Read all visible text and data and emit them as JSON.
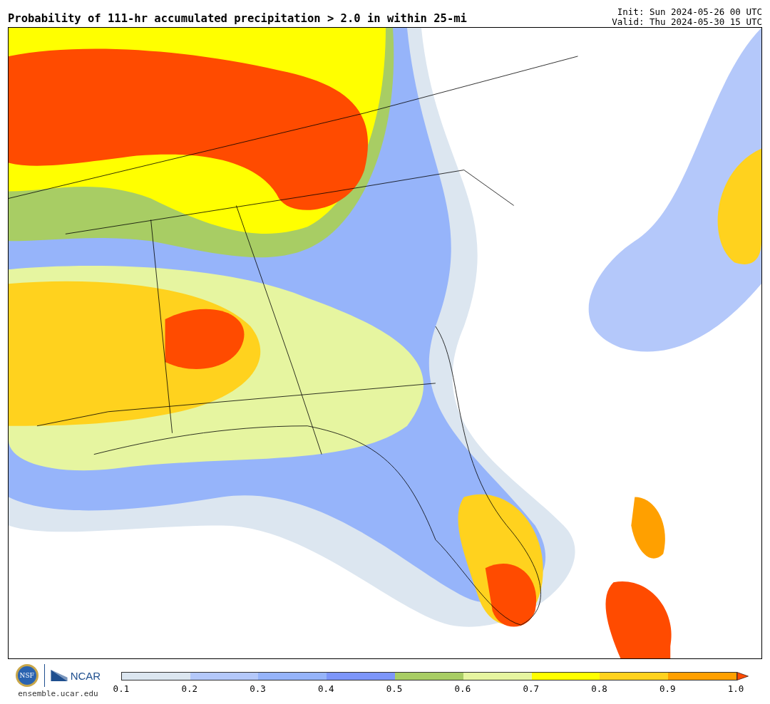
{
  "title": "Probability of 111-hr accumulated precipitation > 2.0 in within 25-mi",
  "init": "Init: Sun 2024-05-26 00 UTC",
  "valid": "Valid: Thu 2024-05-30 15 UTC",
  "logos": {
    "nsf": "NSF",
    "ncar": "NCAR",
    "site": "ensemble.ucar.edu"
  },
  "legend": {
    "segments": [
      {
        "color": "#dce6f0"
      },
      {
        "color": "#b4c8fa"
      },
      {
        "color": "#96b4fa"
      },
      {
        "color": "#7d96fa"
      },
      {
        "color": "#a8cd64"
      },
      {
        "color": "#e6f5a0"
      },
      {
        "color": "#ffff00"
      },
      {
        "color": "#ffd21e"
      },
      {
        "color": "#ffa000"
      }
    ],
    "overflow": {
      "color": "#ff4b00"
    },
    "ticks": [
      "0.1",
      "0.2",
      "0.3",
      "0.4",
      "0.5",
      "0.6",
      "0.7",
      "0.8",
      "0.9",
      "1.0"
    ]
  }
}
